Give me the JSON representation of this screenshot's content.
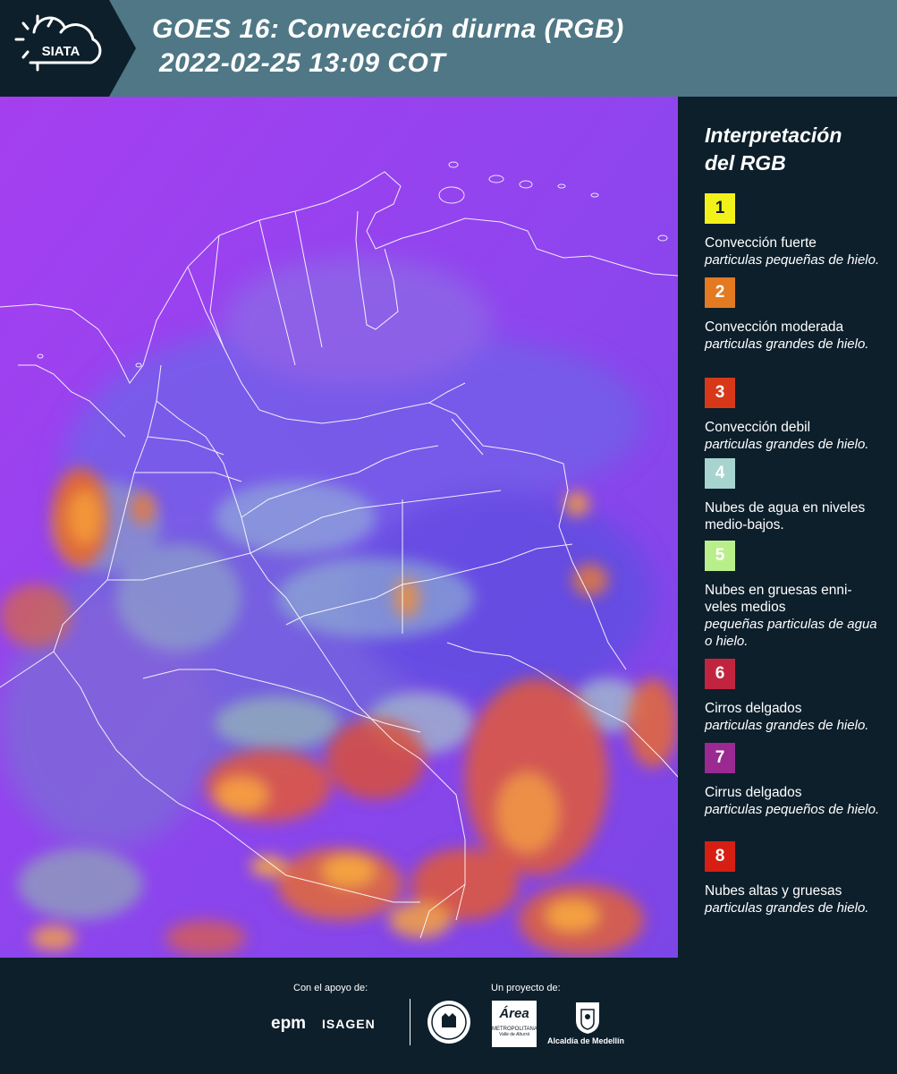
{
  "header": {
    "logo_text": "SIATA",
    "title_line1": "GOES 16: Convección diurna (RGB)",
    "title_line2": "2022-02-25 13:09 COT"
  },
  "colors": {
    "header_bg": "#4f7785",
    "page_bg": "#0d1f2b",
    "map_base": "#9a3df0"
  },
  "legend": {
    "title_line1": "Interpretación",
    "title_line2": "del RGB",
    "items": [
      {
        "number": "1",
        "color": "#f2f21a",
        "number_color": "#0d1f2b",
        "name": "Convección fuerte",
        "desc": "particulas pequeñas de hielo."
      },
      {
        "number": "2",
        "color": "#e37a22",
        "number_color": "#ffffff",
        "name": "Convección moderada",
        "desc": "particulas grandes de hielo."
      },
      {
        "number": "3",
        "color": "#d8381a",
        "number_color": "#ffffff",
        "name": "Convección debil",
        "desc": "particulas grandes de hielo."
      },
      {
        "number": "4",
        "color": "#a7d4cf",
        "number_color": "#ffffff",
        "name": "Nubes de agua en niveles medio-bajos.",
        "desc": ""
      },
      {
        "number": "5",
        "color": "#b9ef8a",
        "number_color": "#ffffff",
        "name": "Nubes en gruesas enni- veles medios",
        "desc": "pequeñas particulas de agua o hielo."
      },
      {
        "number": "6",
        "color": "#c2243f",
        "number_color": "#ffffff",
        "name": "Cirros delgados",
        "desc": "particulas grandes de hielo."
      },
      {
        "number": "7",
        "color": "#9a2a92",
        "number_color": "#ffffff",
        "name": "Cirrus delgados",
        "desc": "particulas pequeños de hielo."
      },
      {
        "number": "8",
        "color": "#d61f12",
        "number_color": "#ffffff",
        "name": "Nubes altas y gruesas",
        "desc": "particulas grandes de hielo."
      }
    ]
  },
  "footer": {
    "support_label": "Con el apoyo de:",
    "project_label": "Un proyecto de:",
    "epm": "epm",
    "isagen": "ISAGEN",
    "area_metropolitana": "Área",
    "area_sub": "METROPOLITANA",
    "area_sub2": "Valle de Aburrá",
    "alcaldia": "Alcaldía de Medellín"
  }
}
